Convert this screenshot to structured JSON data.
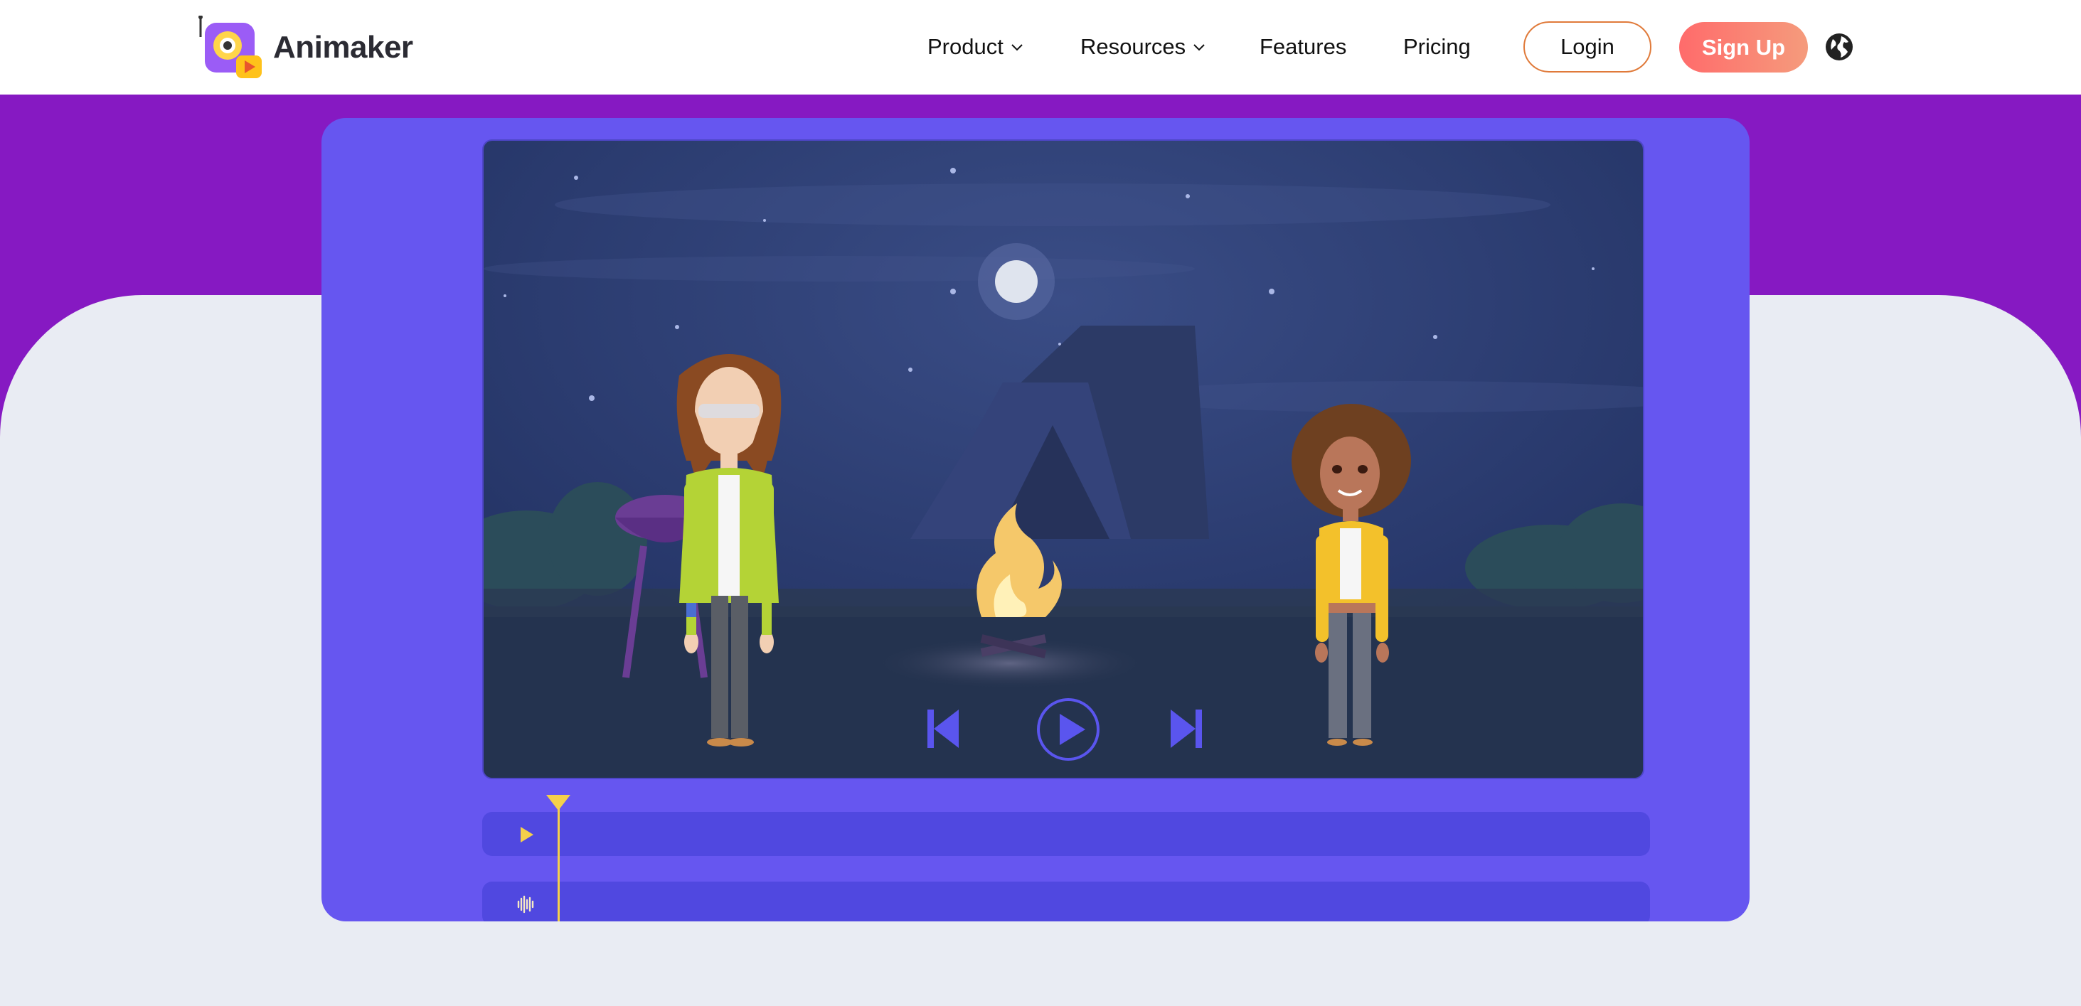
{
  "header": {
    "brand": "Animaker",
    "nav": [
      {
        "label": "Product",
        "has_dropdown": true
      },
      {
        "label": "Resources",
        "has_dropdown": true
      },
      {
        "label": "Features",
        "has_dropdown": false
      },
      {
        "label": "Pricing",
        "has_dropdown": false
      }
    ],
    "login_label": "Login",
    "signup_label": "Sign Up",
    "language_icon": "globe-icon"
  },
  "colors": {
    "accent_purple": "#8619c2",
    "card_purple": "#6656f0",
    "signup_start": "#ff6b6b",
    "signup_end": "#f59b7c",
    "login_border": "#e07a3a",
    "playhead": "#f5d04a"
  },
  "player": {
    "controls": [
      "previous-icon",
      "play-icon",
      "next-icon"
    ]
  },
  "timeline": {
    "tracks": [
      {
        "icon": "video-track-icon"
      },
      {
        "icon": "audio-track-icon"
      }
    ]
  }
}
